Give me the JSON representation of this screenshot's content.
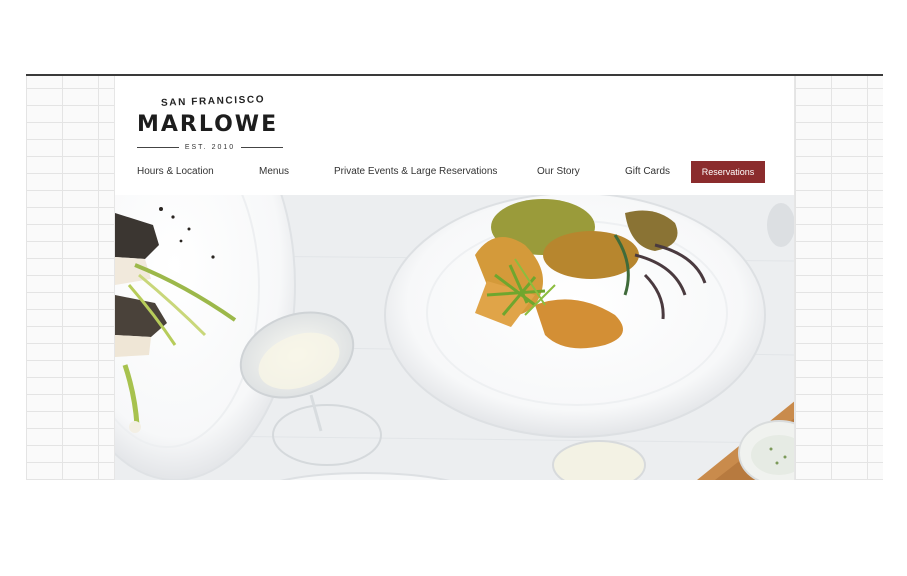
{
  "brand": {
    "location": "SAN FRANCISCO",
    "name": "MARLOWE",
    "established": "EST. 2010"
  },
  "nav": {
    "items": [
      {
        "label": "Hours & Location"
      },
      {
        "label": "Menus"
      },
      {
        "label": "Private Events & Large Reservations"
      },
      {
        "label": "Our Story"
      },
      {
        "label": "Gift Cards"
      }
    ],
    "cta_label": "Reservations"
  },
  "colors": {
    "accent": "#8b2c2d",
    "rule": "#3a3a3a"
  },
  "hero": {
    "image": "food-photo-plates-and-wine"
  }
}
